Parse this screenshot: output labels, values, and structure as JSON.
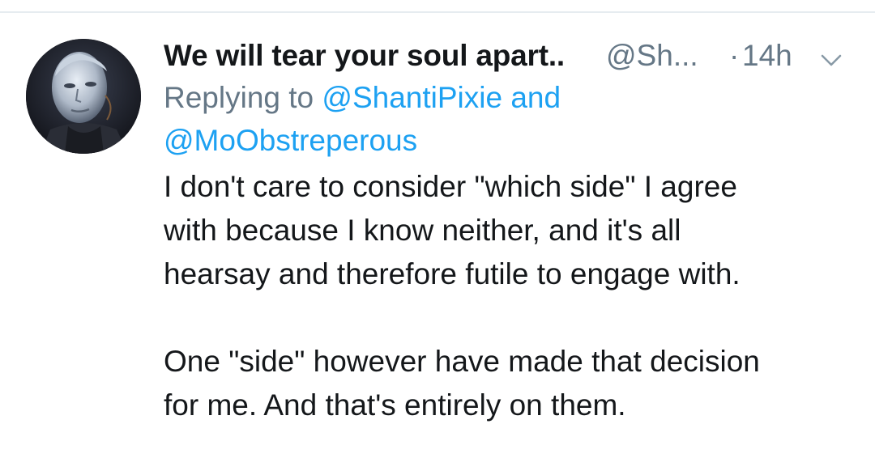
{
  "tweet": {
    "display_name": "We will tear your soul apart..",
    "handle": "@Sh...",
    "separator": "·",
    "timestamp": "14h",
    "menu_icon": "chevron-down-icon",
    "avatar_icon": "avatar-portrait",
    "reply": {
      "prefix": "Replying to",
      "mention_1": "@ShantiPixie",
      "conjunction": "and",
      "mention_2": "@MoObstreperous"
    },
    "body": {
      "line_1": "I don't care to consider \"which side\" I agree",
      "line_2": "with because I know neither, and it's all",
      "line_3": "hearsay and therefore futile to engage with.",
      "line_4": "One \"side\" however have made that decision",
      "line_5": "for me. And that's entirely on them."
    }
  },
  "colors": {
    "text_primary": "#14171a",
    "text_secondary": "#657786",
    "link": "#1da1f2",
    "divider": "#e6ecf0"
  }
}
